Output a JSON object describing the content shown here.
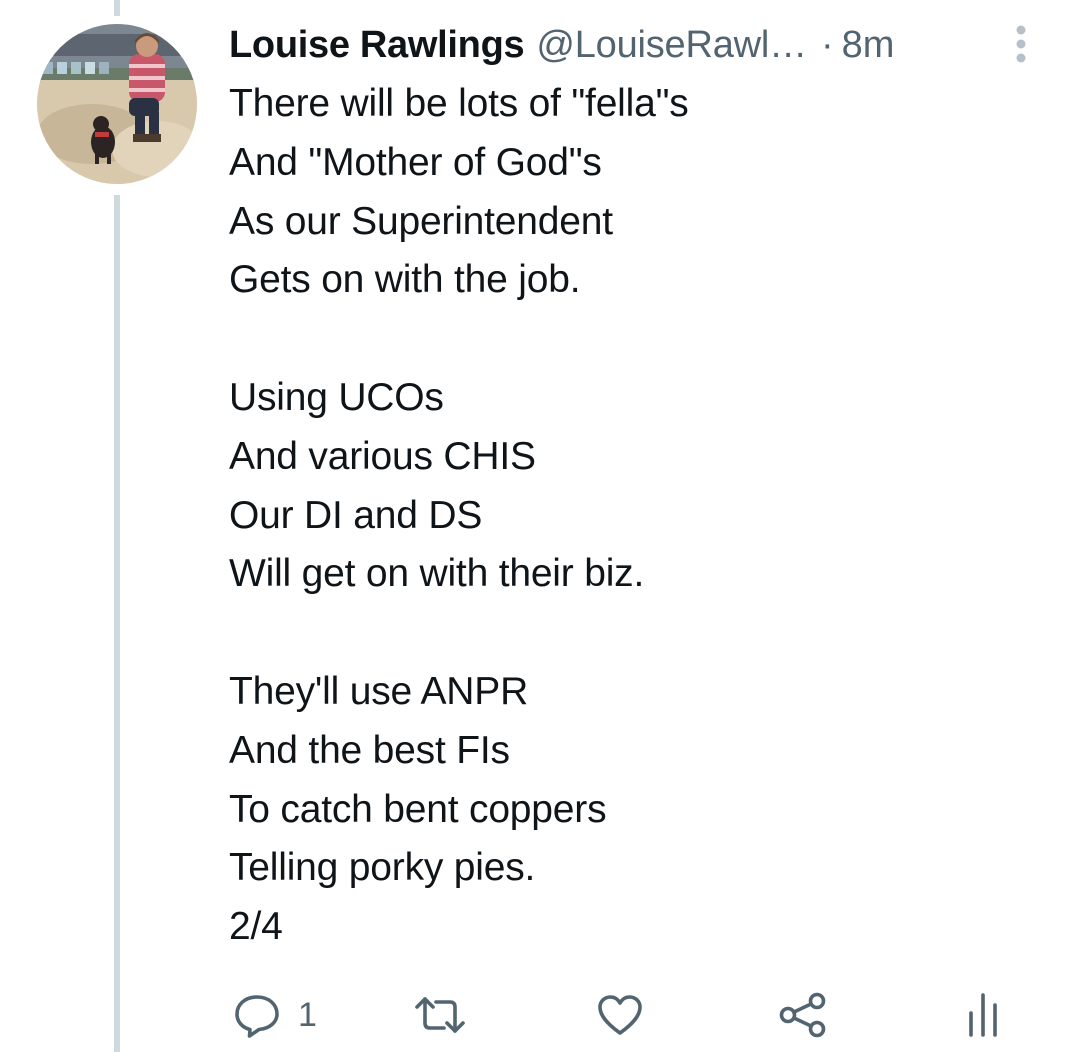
{
  "tweet": {
    "author": {
      "display_name": "Louise Rawlings",
      "handle": "@LouiseRawl…",
      "separator": "·",
      "time": "8m"
    },
    "body": "There will be lots of \"fella\"s\nAnd \"Mother of God\"s\nAs our Superintendent\nGets on with the job.\n\nUsing UCOs\nAnd various CHIS\nOur DI and DS\nWill get on with their biz.\n\nThey'll use ANPR\nAnd the best FIs\nTo catch bent coppers\nTelling porky pies.\n2/4",
    "actions": {
      "reply_icon": "reply-icon",
      "reply_count": "1",
      "retweet_icon": "retweet-icon",
      "like_icon": "heart-icon",
      "share_icon": "share-icon",
      "analytics_icon": "analytics-icon"
    }
  },
  "colors": {
    "text_primary": "#0f1419",
    "text_secondary": "#536471",
    "thread_line": "#cfd9de",
    "background": "#ffffff"
  }
}
